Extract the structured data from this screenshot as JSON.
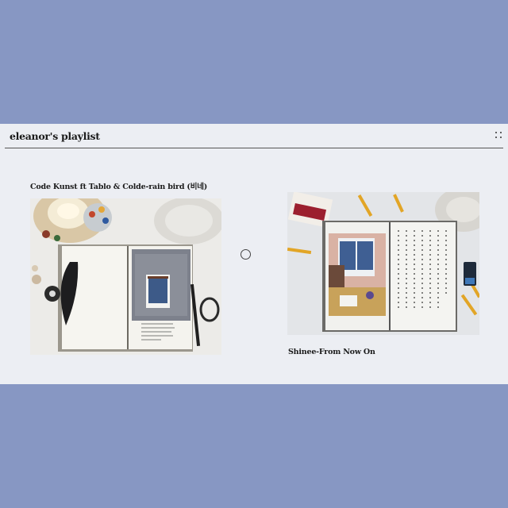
{
  "playlist": {
    "title": "eleanor's playlist"
  },
  "items": [
    {
      "caption": "Code Kunst ft Tablo & Colde-rain bird (비네)",
      "image": "sketchbook-rainy-window-painting"
    },
    {
      "caption": "Shinee-From Now On",
      "image": "sketchbook-room-interior-painting"
    }
  ],
  "colors": {
    "background": "#8797c3",
    "panel": "#eceef3",
    "text": "#1a1a1a"
  },
  "icons": {
    "grip": "drag-grip-icon",
    "selector": "radio-circle-icon"
  }
}
